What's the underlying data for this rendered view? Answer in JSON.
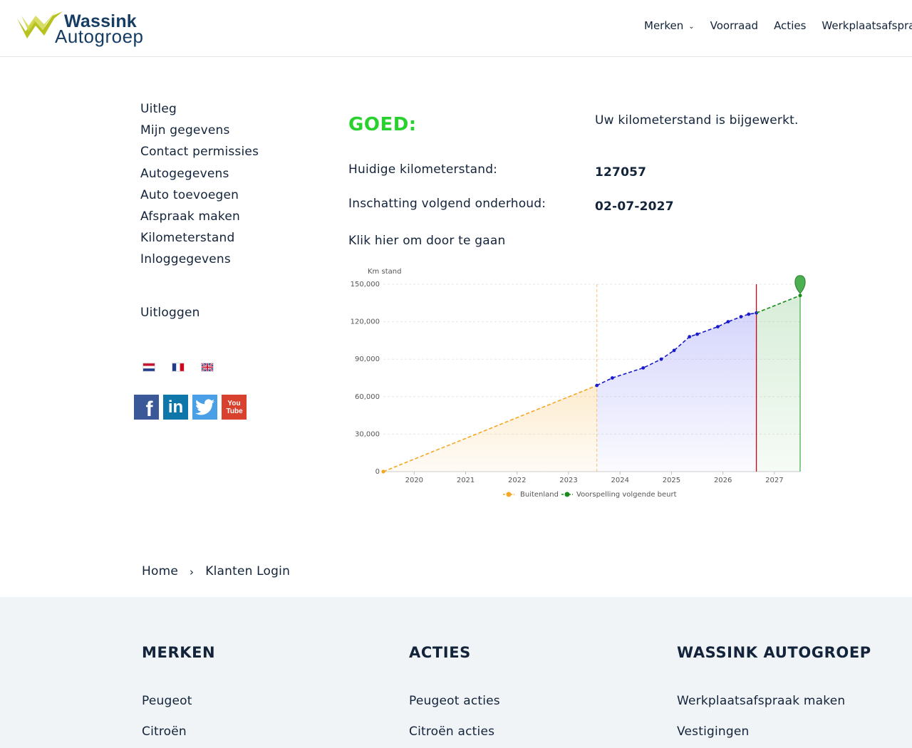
{
  "header": {
    "logo": {
      "line1": "Wassink",
      "line2": "Autogroep"
    },
    "nav": [
      {
        "label": "Merken",
        "has_dropdown": true
      },
      {
        "label": "Voorraad"
      },
      {
        "label": "Acties"
      },
      {
        "label": "Werkplaatsafspra"
      }
    ]
  },
  "sidebar": {
    "items": [
      {
        "label": "Uitleg"
      },
      {
        "label": "Mijn gegevens"
      },
      {
        "label": "Contact permissies"
      },
      {
        "label": "Autogegevens"
      },
      {
        "label": "Auto toevoegen"
      },
      {
        "label": "Afspraak maken"
      },
      {
        "label": "Kilometerstand"
      },
      {
        "label": "Inloggegevens"
      }
    ],
    "logout": "Uitloggen",
    "languages": [
      "nl-flag-icon",
      "fr-flag-icon",
      "gb-flag-icon"
    ],
    "socials": [
      {
        "icon": "facebook-icon",
        "glyph": "f"
      },
      {
        "icon": "linkedin-icon",
        "glyph": "in"
      },
      {
        "icon": "twitter-icon",
        "glyph": ""
      },
      {
        "icon": "youtube-icon",
        "glyph": "You Tube"
      }
    ]
  },
  "main": {
    "status_title": "GOED:",
    "status_message": "Uw kilometerstand is bijgewerkt.",
    "current_km_label": "Huidige kilometerstand:",
    "current_km_value": "127057",
    "next_service_label": "Inschatting volgend onderhoud:",
    "next_service_value": "02-07-2027",
    "continue_link": "Klik hier om door te gaan"
  },
  "chart_data": {
    "type": "line",
    "ylabel": "Km stand",
    "ylim": [
      0,
      150000
    ],
    "yticks": [
      "0",
      "30,000",
      "60,000",
      "90,000",
      "120,000",
      "150,000"
    ],
    "xticks": [
      "2020",
      "2021",
      "2022",
      "2023",
      "2024",
      "2025",
      "2026",
      "2027"
    ],
    "x_range": [
      2019.4,
      2027.5
    ],
    "series": [
      {
        "name": "Buitenland",
        "color": "#f5a623",
        "style": "dashed",
        "points": [
          [
            2019.4,
            0
          ],
          [
            2023.55,
            69000
          ]
        ]
      },
      {
        "name": "",
        "color": "#1a1acc",
        "style": "dashed",
        "points": [
          [
            2023.55,
            69000
          ],
          [
            2023.85,
            75000
          ],
          [
            2024.45,
            83000
          ],
          [
            2024.8,
            90000
          ],
          [
            2025.05,
            97000
          ],
          [
            2025.35,
            108000
          ],
          [
            2025.5,
            110000
          ],
          [
            2025.9,
            116000
          ],
          [
            2026.1,
            120000
          ],
          [
            2026.35,
            124000
          ],
          [
            2026.5,
            126000
          ],
          [
            2026.65,
            127057
          ]
        ]
      },
      {
        "name": "Voorspelling volgende beurt",
        "color": "#1a8a1a",
        "style": "dashed",
        "points": [
          [
            2026.65,
            127057
          ],
          [
            2027.5,
            141000
          ]
        ]
      }
    ],
    "markers": [
      {
        "x": 2023.55,
        "color": "#f5c16c",
        "style": "dashed"
      },
      {
        "x": 2026.65,
        "color": "#d0021b",
        "style": "solid"
      },
      {
        "x": 2027.5,
        "color": "#4caf50",
        "style": "solid"
      }
    ],
    "legend_position": "bottom-center",
    "grid": true
  },
  "breadcrumb": {
    "home": "Home",
    "separator": "›",
    "current": "Klanten Login"
  },
  "footer": {
    "columns": [
      {
        "title": "MERKEN",
        "links": [
          "Peugeot",
          "Citroën"
        ]
      },
      {
        "title": "ACTIES",
        "links": [
          "Peugeot acties",
          "Citroën acties"
        ]
      },
      {
        "title": "WASSINK AUTOGROEP",
        "links": [
          "Werkplaatsafspraak maken",
          "Vestigingen"
        ]
      }
    ]
  }
}
